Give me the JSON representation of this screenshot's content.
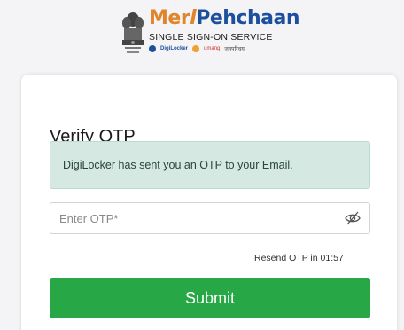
{
  "header": {
    "brand_part1": "Mer",
    "brand_part2": "Pehchaan",
    "subtitle": "SINGLE SIGN-ON SERVICE",
    "partners": [
      "DigiLocker",
      "umang",
      "जनपरिचय"
    ],
    "emblem_icon": "national-emblem-icon",
    "colors": {
      "brand_orange": "#e0852b",
      "brand_blue": "#1e4f9e"
    }
  },
  "card": {
    "title": "Verify OTP",
    "alert_message": "DigiLocker has sent you an OTP to your Email.",
    "otp_field": {
      "value": "",
      "placeholder": "Enter OTP*",
      "toggle_icon": "eye-slash-icon"
    },
    "resend_text": "Resend OTP in 01:57",
    "submit_label": "Submit",
    "colors": {
      "alert_bg": "#d5e8e1",
      "submit_bg": "#27a745"
    }
  }
}
